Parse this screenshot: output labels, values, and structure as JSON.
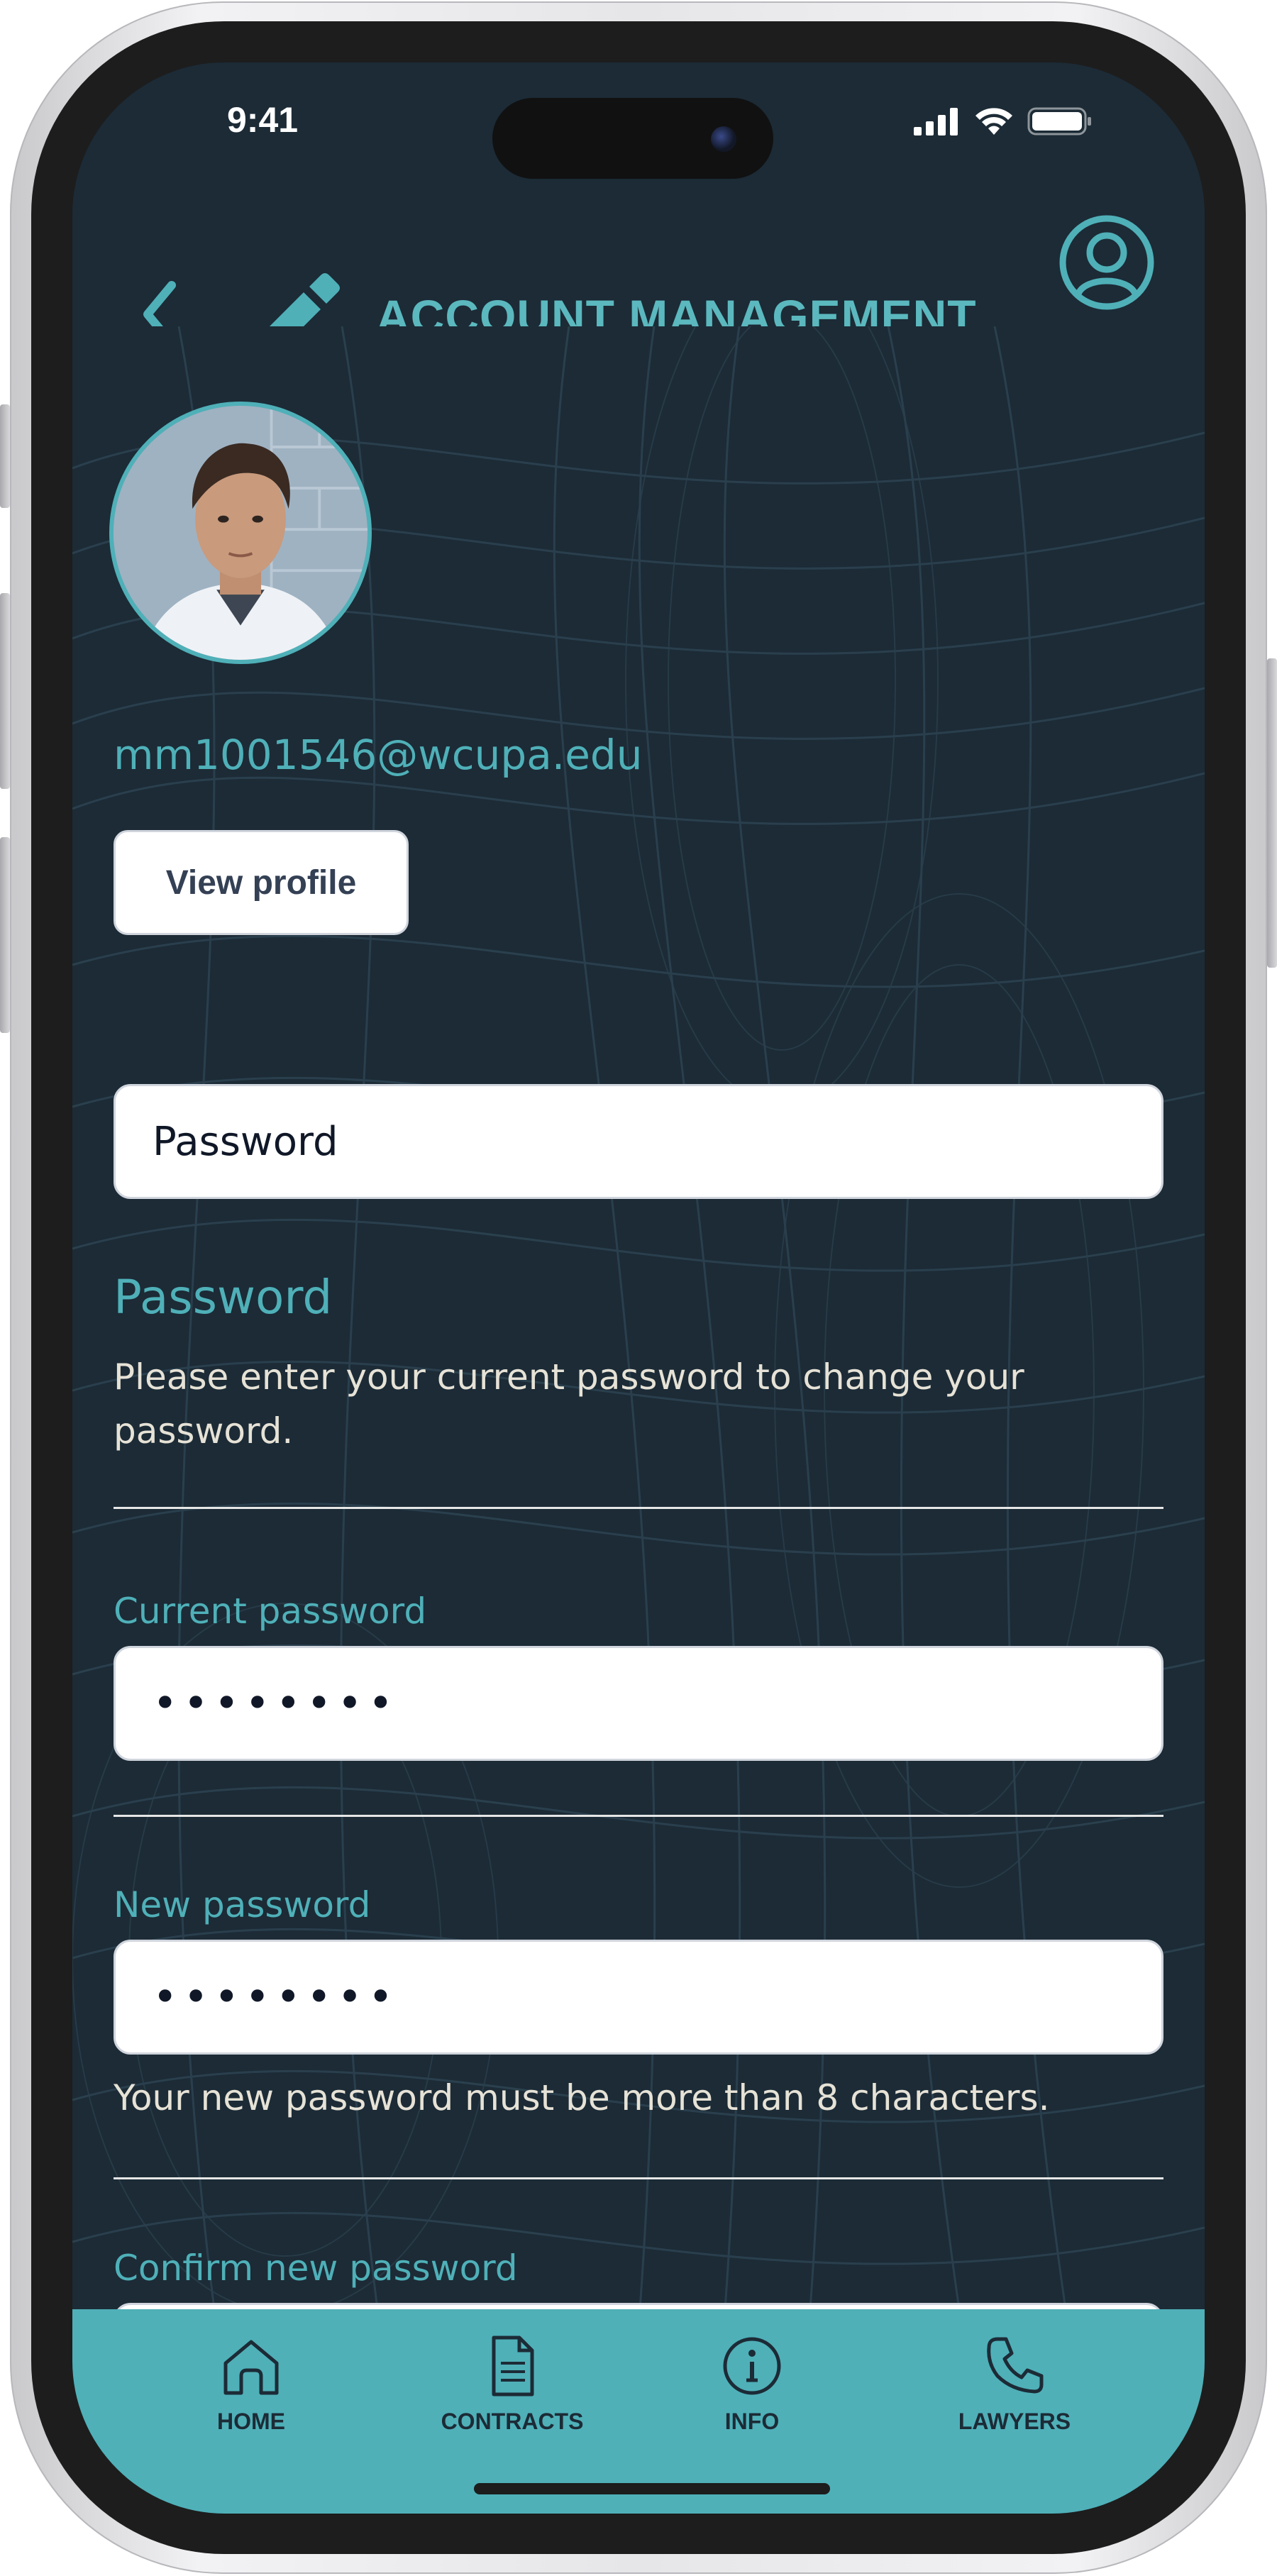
{
  "status_bar": {
    "time": "9:41"
  },
  "header": {
    "title": "ACCOUNT MANAGEMENT"
  },
  "profile": {
    "email": "mm1001546@wcupa.edu",
    "view_profile_label": "View profile"
  },
  "section": {
    "selector_label": "Password",
    "title": "Password",
    "description": "Please enter your current password to change your password."
  },
  "form": {
    "current_label": "Current password",
    "current_value": "••••••••",
    "new_label": "New password",
    "new_value": "••••••••",
    "new_hint": "Your new password must be more than 8 characters.",
    "confirm_label": "Confirm new password",
    "confirm_value": "••••••••"
  },
  "nav": {
    "items": [
      {
        "label": "HOME",
        "icon": "home-icon"
      },
      {
        "label": "CONTRACTS",
        "icon": "document-icon"
      },
      {
        "label": "INFO",
        "icon": "info-icon"
      },
      {
        "label": "LAWYERS",
        "icon": "phone-icon"
      }
    ]
  },
  "colors": {
    "accent": "#4fb0b8",
    "background": "#1c2b36",
    "nav_background": "#4fb0b8"
  }
}
